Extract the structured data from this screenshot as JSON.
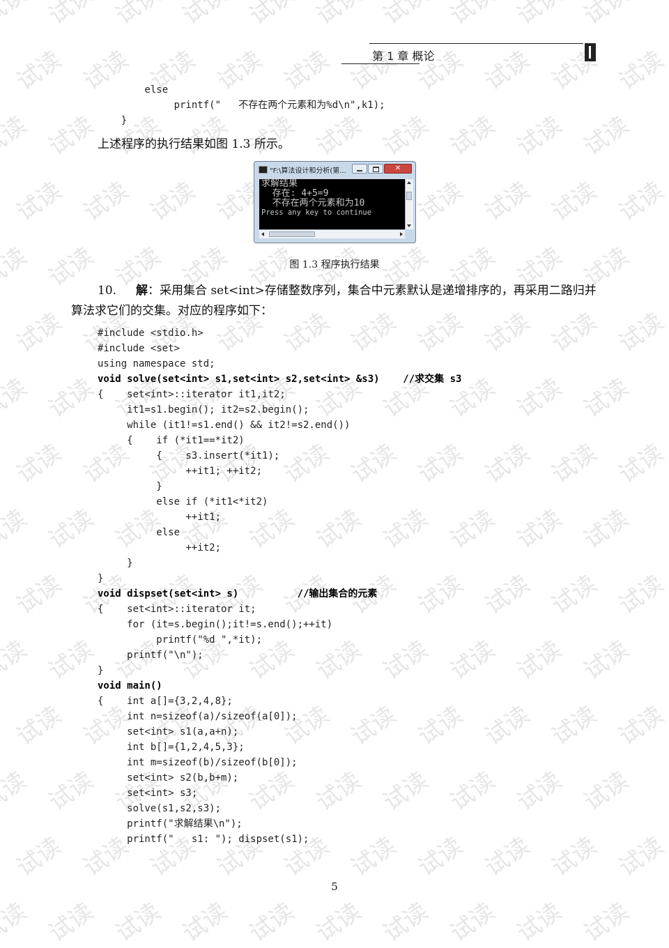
{
  "header": {
    "title": "第 1 章   概论"
  },
  "code_top": "        else\n             printf(\"   不存在两个元素和为%d\\n\",k1);\n    }",
  "para1": "上述程序的执行结果如图 1.3 所示。",
  "console_window": {
    "title": "\"F:\\算法设计和分析(第...",
    "close_label": "✕",
    "lines": [
      "求解结果",
      "  存在: 4+5=9",
      "  不存在两个元素和为10",
      "Press any key to continue"
    ]
  },
  "figure_caption": "图 1.3    程序执行结果",
  "para2": {
    "number": "10.",
    "label": "解",
    "text": "：采用集合 set<int>存储整数序列，集合中元素默认是递增排序的，再采用二路归并算法求它们的交集。对应的程序如下："
  },
  "code_main": {
    "lines_a": "#include <stdio.h>\n#include <set>\nusing namespace std;",
    "solve_sig": "void solve(set<int> s1,set<int> s2,set<int> &s3)    //求交集 s3",
    "solve_body": "{    set<int>::iterator it1,it2;\n     it1=s1.begin(); it2=s2.begin();\n     while (it1!=s1.end() && it2!=s2.end())\n     {    if (*it1==*it2)\n          {    s3.insert(*it1);\n               ++it1; ++it2;\n          }\n          else if (*it1<*it2)\n               ++it1;\n          else\n               ++it2;\n     }\n}",
    "dispset_sig": "void dispset(set<int> s)          //输出集合的元素",
    "dispset_body": "{    set<int>::iterator it;\n     for (it=s.begin();it!=s.end();++it)\n          printf(\"%d \",*it);\n     printf(\"\\n\");\n}",
    "main_sig": "void main()",
    "main_body": "{    int a[]={3,2,4,8};\n     int n=sizeof(a)/sizeof(a[0]);\n     set<int> s1(a,a+n);\n     int b[]={1,2,4,5,3};\n     int m=sizeof(b)/sizeof(b[0]);\n     set<int> s2(b,b+m);\n     set<int> s3;\n     solve(s1,s2,s3);\n     printf(\"求解结果\\n\");\n     printf(\"   s1: \"); dispset(s1);"
  },
  "page_number": "5",
  "watermark": "试读"
}
